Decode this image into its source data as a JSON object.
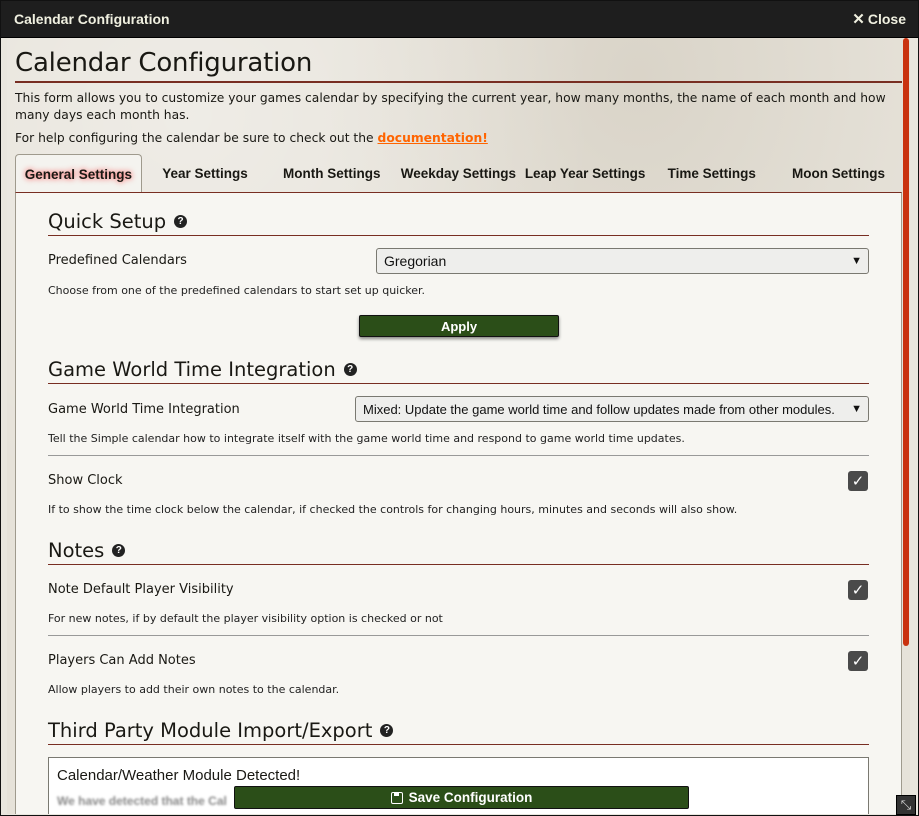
{
  "window": {
    "title": "Calendar Configuration",
    "close_label": "Close"
  },
  "page": {
    "title": "Calendar Configuration",
    "intro": "This form allows you to customize your games calendar by specifying the current year, how many months, the name of each month and how many days each month has.",
    "help_prefix": "For help configuring the calendar be sure to check out the ",
    "help_link": "documentation!"
  },
  "tabs": [
    {
      "label": "General Settings",
      "active": true
    },
    {
      "label": "Year Settings",
      "active": false
    },
    {
      "label": "Month Settings",
      "active": false
    },
    {
      "label": "Weekday Settings",
      "active": false
    },
    {
      "label": "Leap Year Settings",
      "active": false
    },
    {
      "label": "Time Settings",
      "active": false
    },
    {
      "label": "Moon Settings",
      "active": false
    }
  ],
  "quick_setup": {
    "heading": "Quick Setup",
    "label": "Predefined Calendars",
    "value": "Gregorian",
    "hint": "Choose from one of the predefined calendars to start set up quicker.",
    "apply_label": "Apply"
  },
  "time_integration": {
    "heading": "Game World Time Integration",
    "label": "Game World Time Integration",
    "value": "Mixed: Update the game world time and follow updates made from other modules.",
    "hint": "Tell the Simple calendar how to integrate itself with the game world time and respond to game world time updates.",
    "show_clock_label": "Show Clock",
    "show_clock_checked": true,
    "show_clock_hint": "If to show the time clock below the calendar, if checked the controls for changing hours, minutes and seconds will also show."
  },
  "notes": {
    "heading": "Notes",
    "visibility_label": "Note Default Player Visibility",
    "visibility_checked": true,
    "visibility_hint": "For new notes, if by default the player visibility option is checked or not",
    "players_add_label": "Players Can Add Notes",
    "players_add_checked": true,
    "players_add_hint": "Allow players to add their own notes to the calendar."
  },
  "third_party": {
    "heading": "Third Party Module Import/Export",
    "detected_title": "Calendar/Weather Module Detected!",
    "detected_text": "We have detected that the Cal"
  },
  "footer": {
    "save_label": "Save Configuration"
  },
  "colors": {
    "accent_link": "#ff6400",
    "button_green": "#2b4e18",
    "section_rule": "#782e22",
    "scrollbar": "#c9320f"
  }
}
